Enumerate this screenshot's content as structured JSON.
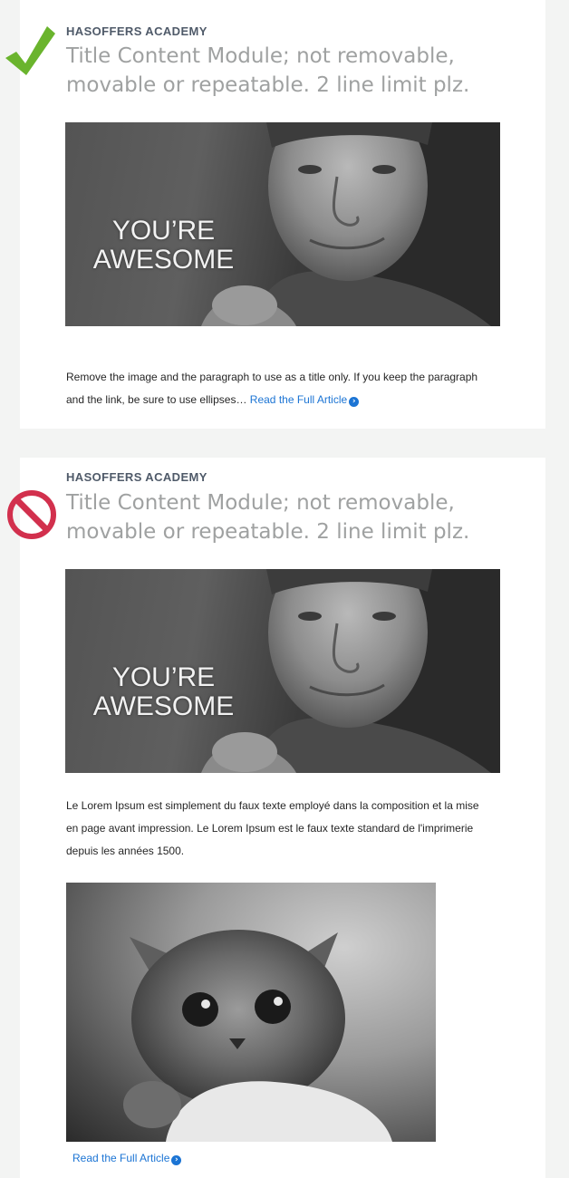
{
  "cards": [
    {
      "status": "approved",
      "eyebrow": "HASOFFERS ACADEMY",
      "title": "Title Content Module; not removable, movable or repeatable. 2 line limit plz.",
      "image_caption_line1": "YOU’RE",
      "image_caption_line2": "AWESOME",
      "paragraph": "Remove the image and the paragraph to use as a title only. If you keep the paragraph and the link, be sure to use ellipses…",
      "link_label": "Read the Full Article"
    },
    {
      "status": "rejected",
      "eyebrow": "HASOFFERS ACADEMY",
      "title": "Title Content Module; not removable, movable or repeatable. 2 line limit plz.",
      "image_caption_line1": "YOU’RE",
      "image_caption_line2": "AWESOME",
      "paragraph": "Le Lorem Ipsum est simplement du faux texte employé dans la composition et la mise en page avant impression. Le Lorem Ipsum est le faux texte standard de l'imprimerie depuis les années 1500.",
      "link_label": "Read the Full Article"
    }
  ],
  "icons": {
    "approved": "checkmark-icon",
    "rejected": "no-entry-icon",
    "link_chevron": "chevron-right-circle-icon"
  },
  "colors": {
    "page_background": "#f3f4f3",
    "card_background": "#ffffff",
    "eyebrow": "#4f5a69",
    "title": "#9fa1a1",
    "link": "#1b74d4",
    "check": "#6ab42d",
    "no_entry": "#d2304d"
  }
}
